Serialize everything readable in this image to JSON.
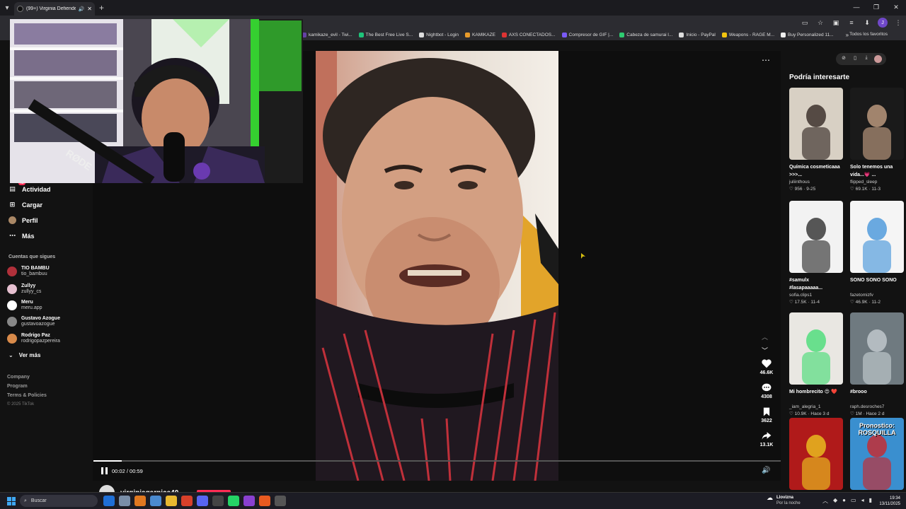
{
  "browser": {
    "active_tab_title": "(99+) Virginia Defiende Su I",
    "bookmarks": [
      {
        "label": "kamikaze_evil - Twi...",
        "color": "#6441a5"
      },
      {
        "label": "The Best Free Live S...",
        "color": "#1ec47a"
      },
      {
        "label": "Nightbot - Login",
        "color": "#dddddd"
      },
      {
        "label": "KAMIKAZE",
        "color": "#e89b2a"
      },
      {
        "label": "AXS CONECTADOS...",
        "color": "#d33"
      },
      {
        "label": "Compresor de GIF |...",
        "color": "#7a5af8"
      },
      {
        "label": "Cabeza de samurai l...",
        "color": "#2ecc71"
      },
      {
        "label": "Inicio - PayPal",
        "color": "#dddddd"
      },
      {
        "label": "Weapons - RAGE M...",
        "color": "#f1c40f"
      },
      {
        "label": "Buy Personalized 11...",
        "color": "#eeeeee"
      }
    ],
    "bookmarks_folder": "Todos los favoritos",
    "profile_initial": "J"
  },
  "sidebar": {
    "activity": {
      "label": "Actividad",
      "badge": "46"
    },
    "upload": "Cargar",
    "profile": "Perfil",
    "more": "Más",
    "following_title": "Cuentas que sigues",
    "following": [
      {
        "name": "TIO BAMBU",
        "handle": "tio_bambuu",
        "color": "#b0303a"
      },
      {
        "name": "Zullyy",
        "handle": "zullyy_cs",
        "color": "#e6c0d0"
      },
      {
        "name": "Meru",
        "handle": "meru.app",
        "color": "#ffffff"
      },
      {
        "name": "Gustavo Azogue",
        "handle": "gustavoazogue",
        "color": "#888888"
      },
      {
        "name": "Rodrigo Paz",
        "handle": "rodrigopazpereira",
        "color": "#d88a4a"
      }
    ],
    "see_more": "Ver más",
    "footer": {
      "company": "Company",
      "program": "Program",
      "terms": "Terms & Policies",
      "copyright": "© 2025 TikTok"
    }
  },
  "video": {
    "progress": 0.041,
    "current_time": "00:02",
    "duration": "00:59",
    "author": "virginiagarnica40",
    "likes": "46.6K",
    "comments": "4308",
    "saves": "3622",
    "shares": "13.1K"
  },
  "right_panel": {
    "title": "Podría interesarte",
    "cards": [
      {
        "title": "Química cosmeticaaa >>>...",
        "user": "juliinthous",
        "likes": "956",
        "date": "9-25",
        "bg": "#d8d0c4",
        "fg": "#2a1e1a"
      },
      {
        "title": "Solo tenemos una vida...💗 ...",
        "user": "flipped_sleep",
        "likes": "69.1K",
        "date": "11-3",
        "bg": "#1a1a1a",
        "fg": "#cfa88a"
      },
      {
        "title": "#samulx #lasapaaaaa...",
        "user": "sofia.clips1",
        "likes": "17.5K",
        "date": "11-4",
        "bg": "#f2f2f2",
        "fg": "#222222"
      },
      {
        "title": "SONO SONO SONO",
        "user": "fazetomizfv",
        "likes": "46.9K",
        "date": "11-2",
        "bg": "#f5f5f5",
        "fg": "#3b8fd8"
      },
      {
        "title": "Mi hombrecito 😍 ❤️",
        "user": "_iam_alegria_1",
        "likes": "10.9K",
        "date": "Hace 3 d",
        "bg": "#e9e7e2",
        "fg": "#3ddc70"
      },
      {
        "title": "#brooo",
        "user": "raph.desroches7",
        "likes": "1M",
        "date": "Hace 2 d",
        "bg": "#6f7a80",
        "fg": "#c9d2d6"
      },
      {
        "title": "",
        "user": "",
        "likes": "",
        "date": "",
        "bg": "#b01a1a",
        "fg": "#f0d020"
      },
      {
        "title": "",
        "user": "",
        "likes": "",
        "date": "",
        "bg": "#3a8fcf",
        "fg": "#d62020",
        "overlay": "Pronostico: ROSQUILLA"
      }
    ]
  },
  "taskbar": {
    "search_placeholder": "Buscar",
    "weather_title": "Llovizna",
    "weather_sub": "Por la noche",
    "time": "19:34",
    "date": "13/11/2025"
  }
}
